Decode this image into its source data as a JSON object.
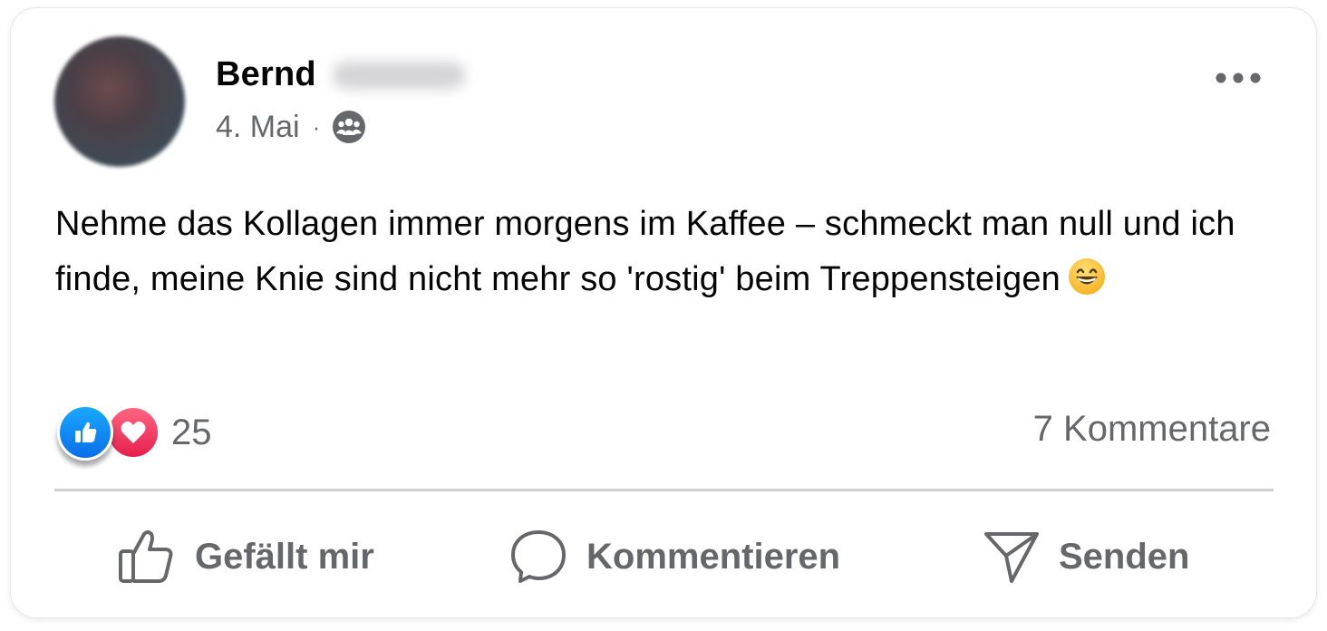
{
  "post": {
    "author_name": "Bernd",
    "date": "4. Mai",
    "separator": "·",
    "audience_icon": "group-icon",
    "body": "Nehme das Kollagen immer morgens im Kaffee – schmeckt man null und ich finde, meine Knie sind nicht mehr so 'rostig' beim Treppensteigen",
    "emoji": "grinning-face-emoji"
  },
  "reactions": {
    "types": [
      "like",
      "love"
    ],
    "count": "25",
    "comments_label": "7 Kommentare"
  },
  "actions": {
    "like_label": "Gefällt mir",
    "comment_label": "Kommentieren",
    "send_label": "Senden"
  },
  "colors": {
    "text_primary": "#050505",
    "text_secondary": "#65676b",
    "like_blue": "#0a6fe8",
    "love_red": "#e61e4d",
    "divider": "#ced0d4"
  }
}
